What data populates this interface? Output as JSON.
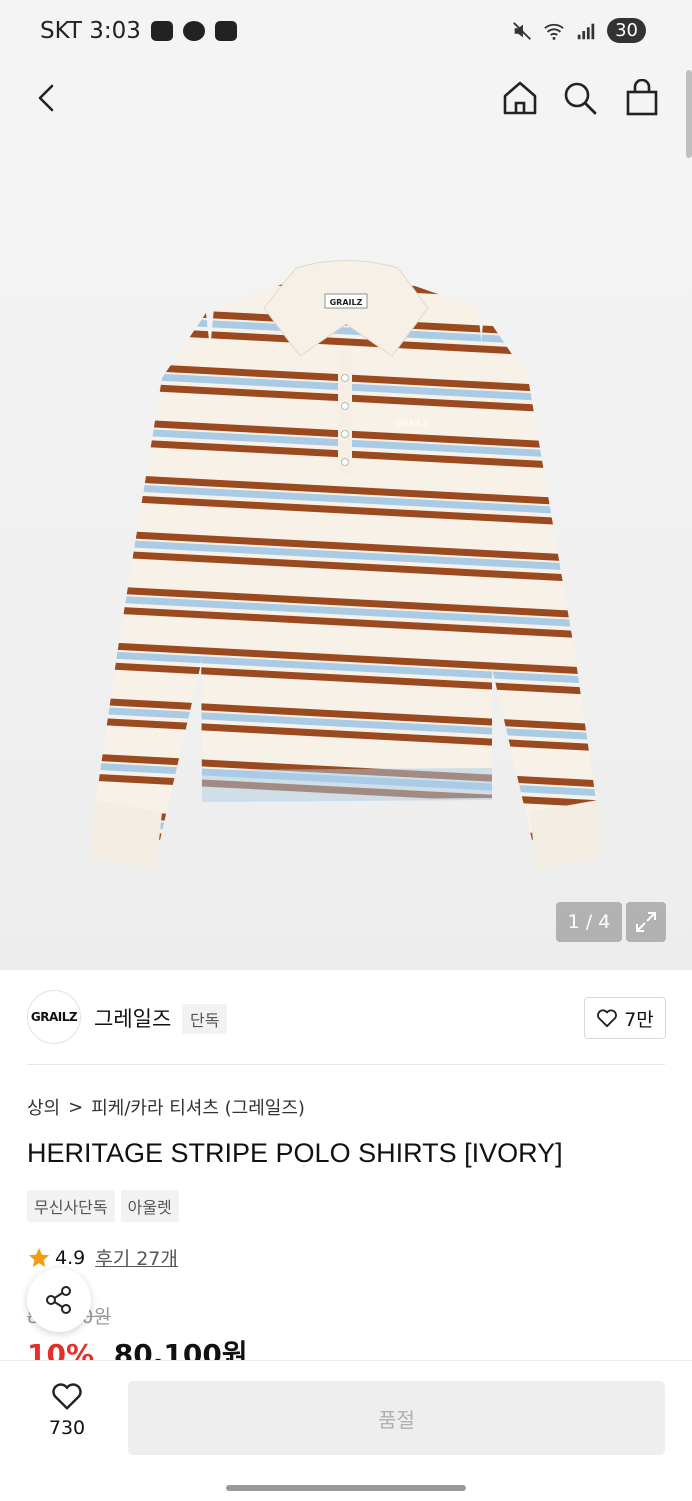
{
  "status_bar": {
    "carrier_time": "SKT 3:03",
    "battery": "30"
  },
  "product": {
    "image_counter": "1 / 4",
    "shirt_label": "GRAILZ",
    "chest_logo": "GRAILZ"
  },
  "brand": {
    "logo_text": "GRAILZ",
    "name": "그레일즈",
    "badge": "단독",
    "likes": "7만"
  },
  "breadcrumb": {
    "category": "상의",
    "separator": ">",
    "subcategory": "피케/카라 티셔츠 (그레일즈)"
  },
  "title": "HERITAGE STRIPE POLO SHIRTS [IVORY]",
  "tags": [
    "무신사단독",
    "아울렛"
  ],
  "rating": {
    "score": "4.9",
    "reviews": "후기 27개"
  },
  "price": {
    "original": "89,000원",
    "discount": "10%",
    "sale": "80,100원"
  },
  "bottom": {
    "like_count": "730",
    "buy_label": "품절"
  },
  "colors": {
    "brown": "#9a4a1e",
    "blue": "#a9cbe6",
    "ivory": "#f7f1e8",
    "sale_red": "#e3302b"
  }
}
